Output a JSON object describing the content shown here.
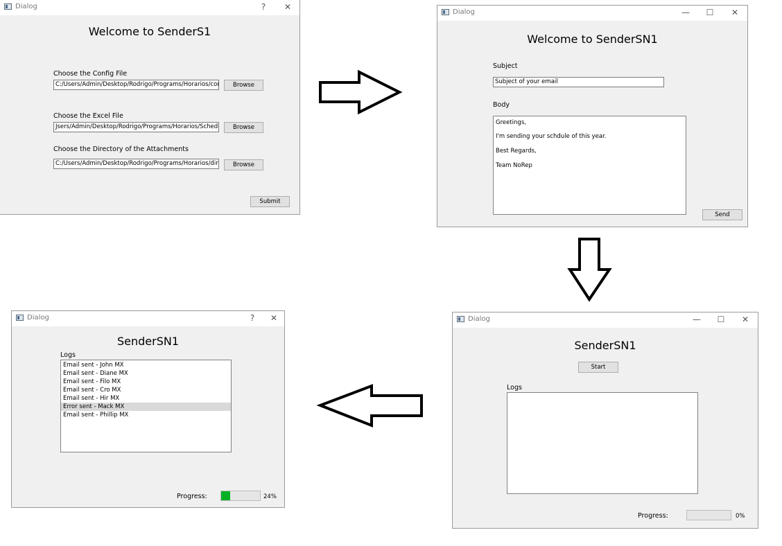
{
  "common": {
    "dialog_title": "Dialog",
    "help_glyph": "?",
    "close_glyph": "✕",
    "minimize_glyph": "—",
    "maximize_glyph": "☐",
    "icons": {
      "app": "dialog-app-icon",
      "help": "help-icon",
      "close": "close-icon",
      "minimize": "minimize-icon",
      "maximize": "maximize-icon",
      "arrow": "arrow-icon"
    }
  },
  "win1": {
    "heading": "Welcome to SenderS1",
    "config_label": "Choose the Config File",
    "config_value": "C:/Users/Admin/Desktop/Rodrigo/Programs/Horarios/config.txt",
    "excel_label": "Choose the Excel File",
    "excel_value": "Jsers/Admin/Desktop/Rodrigo/Programs/Horarios/Schedule.xlsx",
    "dir_label": "Choose the Directory of the Attachments",
    "dir_value": "C:/Users/Admin/Desktop/Rodrigo/Programs/Horarios/directory",
    "browse_label": "Browse",
    "submit_label": "Submit"
  },
  "win2": {
    "heading": "Welcome to SenderSN1",
    "subject_label": "Subject",
    "subject_value": "Subject of your email",
    "body_label": "Body",
    "body_lines": [
      "Greetings,",
      "I'm sending your schdule of this year.",
      "Best Regards,",
      "Team NoRep"
    ],
    "send_label": "Send"
  },
  "win3": {
    "heading": "SenderSN1",
    "start_label": "Start",
    "logs_label": "Logs",
    "progress_label": "Progress:",
    "progress_value": 0,
    "progress_text": "0%"
  },
  "win4": {
    "heading": "SenderSN1",
    "logs_label": "Logs",
    "logs": [
      "Email sent - John MX",
      "Email sent - Diane MX",
      "Email sent - Filo MX",
      "Email sent - Cro MX",
      "Email sent - Hir MX",
      "Error sent - Mack MX",
      "Email sent - Phillip MX"
    ],
    "selected_log_index": 5,
    "progress_label": "Progress:",
    "progress_value": 24,
    "progress_text": "24%",
    "progress_color": "#06b025"
  }
}
